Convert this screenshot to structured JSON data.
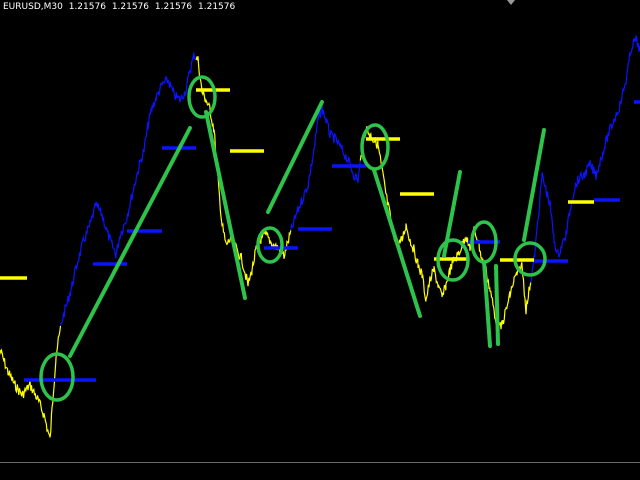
{
  "chart": {
    "symbol": "EURUSD,M30",
    "bid": "1.21576",
    "ask": "1.21576",
    "low": "1.21576",
    "close": "1.21576"
  },
  "colors": {
    "background": "#000000",
    "bull": "#0a14ff",
    "bear": "#ffff00",
    "trend_lines": "#2ec34a",
    "signal_circles": "#2ec34a"
  },
  "icons": [
    "scroll-marker-icon"
  ]
}
